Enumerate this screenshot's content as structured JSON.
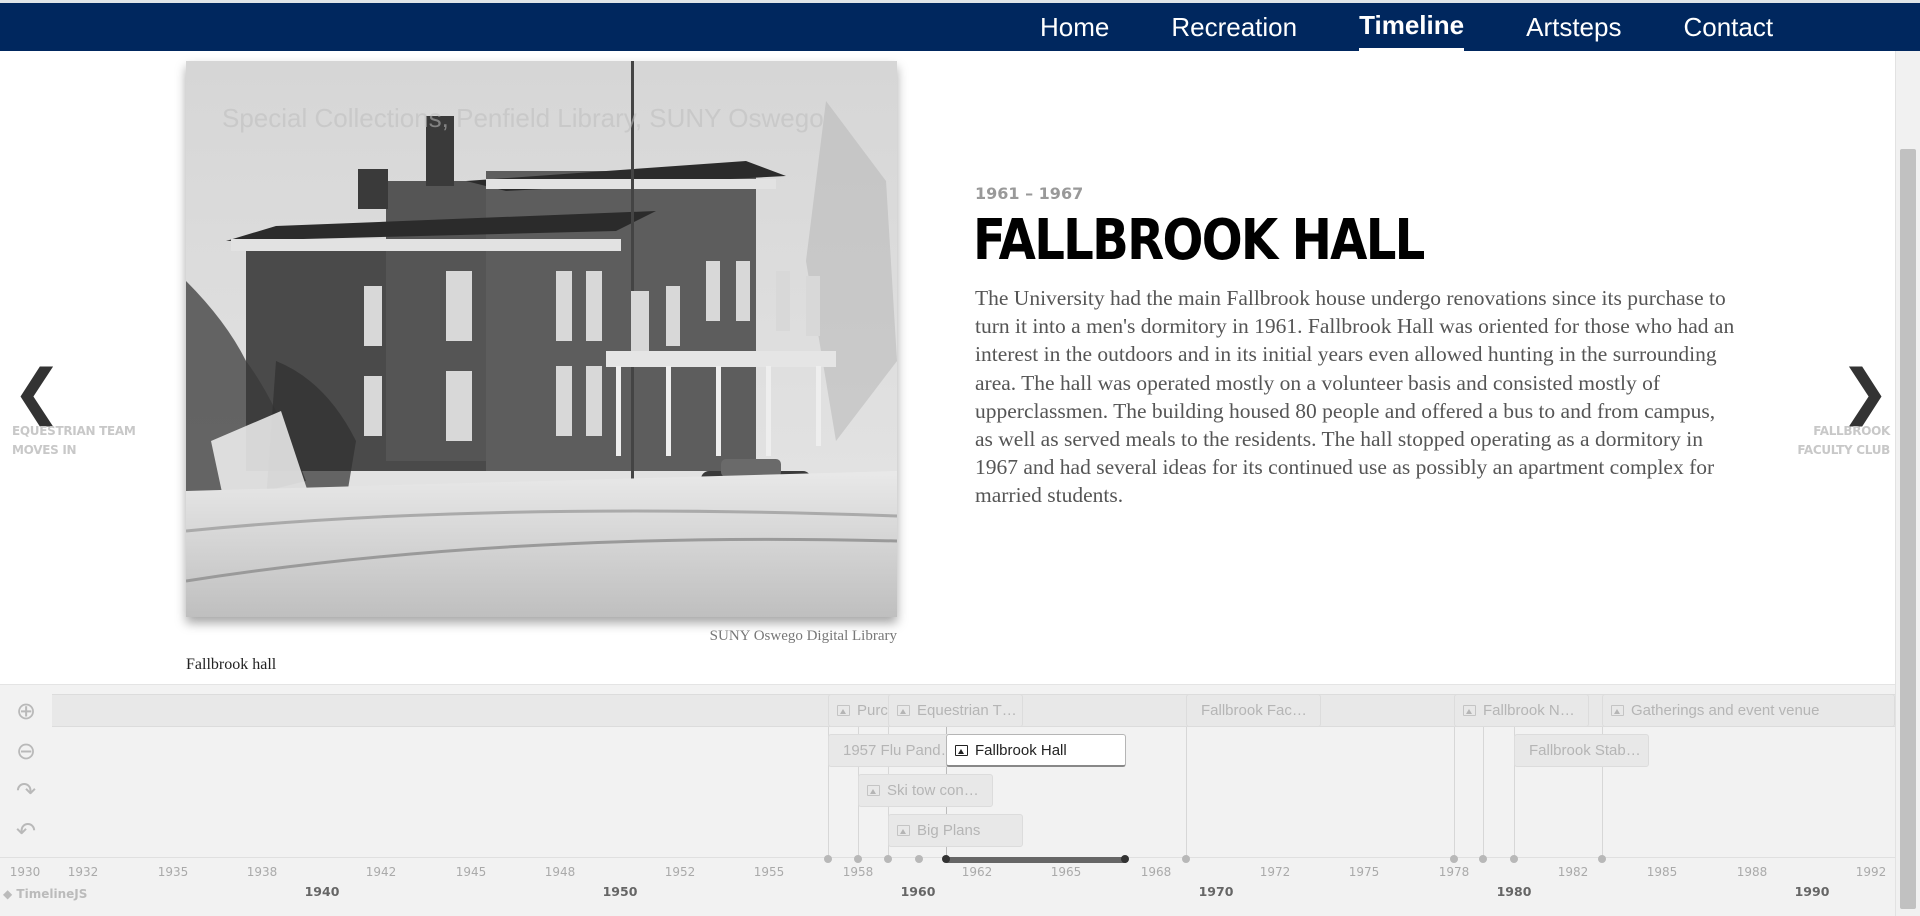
{
  "nav": {
    "items": [
      {
        "label": "Home"
      },
      {
        "label": "Recreation"
      },
      {
        "label": "Timeline",
        "active": true
      },
      {
        "label": "Artsteps"
      },
      {
        "label": "Contact"
      }
    ]
  },
  "slide": {
    "image_watermark": "Special Collections, Penfield Library, SUNY Oswego",
    "credit": "SUNY Oswego Digital Library",
    "caption": "Fallbrook hall",
    "date": "1961 – 1967",
    "headline": "FALLBROOK HALL",
    "text": "The University had the main Fallbrook house undergo renovations since its purchase to turn it into a men's dormitory in 1961. Fallbrook Hall was oriented for those who had an interest in the outdoors and in its initial years even allowed hunting in the surrounding area. The hall was operated mostly on a volunteer basis and consisted mostly of upperclassmen. The building housed 80 people and offered a bus to and from campus, as well as served meals to the residents. The hall stopped operating as a dormitory in 1967 and had several ideas for its continued use as possibly an apartment complex for married students."
  },
  "prev": {
    "icon": "chevron-left-icon",
    "label_line1": "EQUESTRIAN TEAM",
    "label_line2": "MOVES IN"
  },
  "next": {
    "icon": "chevron-right-icon",
    "label_line1": "FALLBROOK",
    "label_line2": "FACULTY CLUB"
  },
  "timeline": {
    "tools": [
      "zoom-in-icon",
      "zoom-out-icon",
      "redo-icon",
      "undo-icon"
    ],
    "brand": "TimelineJS",
    "markers": [
      {
        "label": "Purc…",
        "icon": true
      },
      {
        "label": "Equestrian T…",
        "icon": true
      },
      {
        "label": "Fallbrook Fac…",
        "icon": false
      },
      {
        "label": "Fallbrook N…",
        "icon": true
      },
      {
        "label": "Gatherings and event venue",
        "icon": true
      },
      {
        "label": "1957 Flu Pand…",
        "icon": false
      },
      {
        "label": "Fallbrook Hall",
        "icon": true,
        "active": true
      },
      {
        "label": "Fallbrook Stab…",
        "icon": false
      },
      {
        "label": "Ski tow con…",
        "icon": true
      },
      {
        "label": "Big Plans",
        "icon": true
      }
    ],
    "minor_ticks": [
      "1930",
      "1932",
      "1935",
      "1938",
      "1942",
      "1945",
      "1948",
      "1952",
      "1955",
      "1958",
      "1962",
      "1965",
      "1968",
      "1972",
      "1975",
      "1978",
      "1982",
      "1985",
      "1988",
      "1992"
    ],
    "major_ticks": [
      "1940",
      "1950",
      "1960",
      "1970",
      "1980",
      "1990"
    ]
  },
  "colors": {
    "nav_bg": "#00275e",
    "nav_text": "#ffffff",
    "headline": "#000000",
    "body_text": "#555555"
  }
}
